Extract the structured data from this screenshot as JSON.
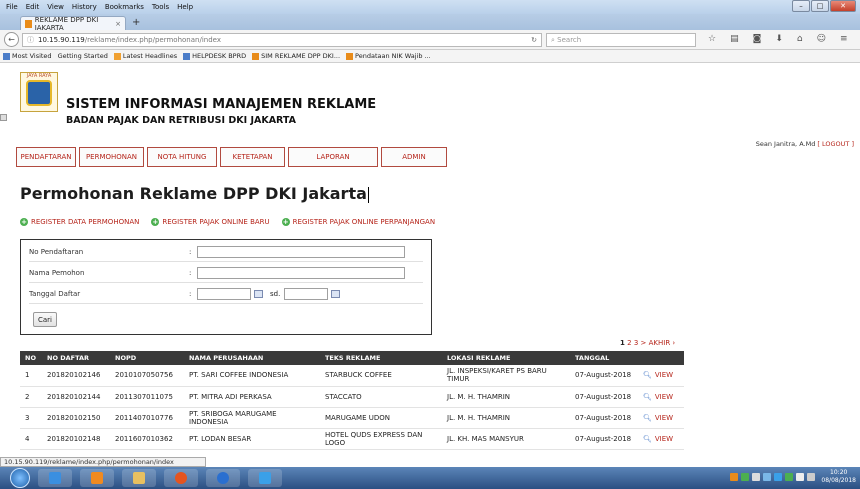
{
  "browser": {
    "menu": [
      "File",
      "Edit",
      "View",
      "History",
      "Bookmarks",
      "Tools",
      "Help"
    ],
    "tab_title": "REKLAME DPP DKI JAKARTA",
    "url_host": "10.15.90.119",
    "url_path": "/reklame/index.php/permohonan/index",
    "search_placeholder": "Search",
    "bookmarks": [
      "Most Visited",
      "Getting Started",
      "Latest Headlines",
      "HELPDESK BPRD",
      "SIM REKLAME DPP DKI...",
      "Pendataan NIK Wajib ..."
    ],
    "status_url": "10.15.90.119/reklame/index.php/permohonan/index"
  },
  "header": {
    "logo_text": "JAYA RAYA",
    "title": "SISTEM INFORMASI MANAJEMEN REKLAME",
    "subtitle": "BADAN PAJAK DAN RETRIBUSI DKI JAKARTA",
    "user": "Sean Janitra, A.Md",
    "logout": "[ LOGOUT ]"
  },
  "nav": [
    "PENDAFTARAN",
    "PERMOHONAN",
    "NOTA HITUNG",
    "KETETAPAN",
    "LAPORAN",
    "ADMIN"
  ],
  "page_title": "Permohonan Reklame DPP DKI Jakarta",
  "actions": [
    "REGISTER DATA PERMOHONAN",
    "REGISTER PAJAK ONLINE BARU",
    "REGISTER PAJAK ONLINE PERPANJANGAN"
  ],
  "form": {
    "no_pendaftaran": "No Pendaftaran",
    "nama_pemohon": "Nama Pemohon",
    "tanggal_daftar": "Tanggal Daftar",
    "colon": ":",
    "sd": "sd.",
    "cari": "Cari"
  },
  "pager": {
    "current": "1",
    "p2": "2",
    "p3": "3",
    "next": ">",
    "last": "AKHIR ›"
  },
  "table": {
    "headers": [
      "NO",
      "NO DAFTAR",
      "NOPD",
      "NAMA PERUSAHAAN",
      "TEKS REKLAME",
      "LOKASI REKLAME",
      "TANGGAL",
      ""
    ],
    "view_label": "VIEW",
    "rows": [
      [
        "1",
        "201820102146",
        "2010107050756",
        "PT. SARI COFFEE INDONESIA",
        "STARBUCK COFFEE",
        "JL. INSPEKSI/KARET PS BARU TIMUR",
        "07-August-2018"
      ],
      [
        "2",
        "201820102144",
        "2011307011075",
        "PT. MITRA ADI PERKASA",
        "STACCATO",
        "JL. M. H. THAMRIN",
        "07-August-2018"
      ],
      [
        "3",
        "201820102150",
        "2011407010776",
        "PT. SRIBOGA MARUGAME INDONESIA",
        "MARUGAME UDON",
        "JL. M. H. THAMRIN",
        "07-August-2018"
      ],
      [
        "4",
        "201820102148",
        "2011607010362",
        "PT. LODAN BESAR",
        "HOTEL QUDS EXPRESS DAN LOGO",
        "JL. KH. MAS MANSYUR",
        "07-August-2018"
      ]
    ]
  },
  "taskbar": {
    "time": "10:20",
    "date": "08/08/2018"
  }
}
